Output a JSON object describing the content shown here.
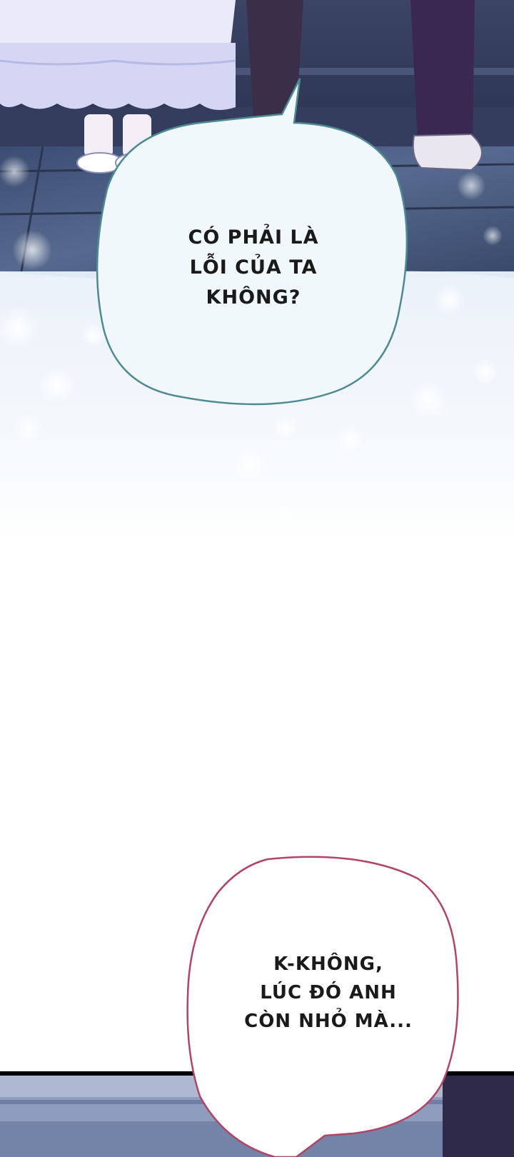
{
  "bubbles": [
    {
      "lines": [
        "CÓ PHẢI LÀ",
        "LỖI CỦA TA",
        "KHÔNG?"
      ]
    },
    {
      "lines": [
        "K-KHÔNG,",
        "LÚC ĐÓ ANH",
        "CÒN NHỎ MÀ..."
      ]
    }
  ],
  "colors": {
    "floor_dark": "#2a3552",
    "wall_dark": "#3a4566",
    "glow": "#dfeaf7",
    "bubble1_fill": "#f1f8fb",
    "bubble1_border": "#4e8a92",
    "bubble2_fill": "#ffffff",
    "bubble2_border": "#b24466"
  }
}
